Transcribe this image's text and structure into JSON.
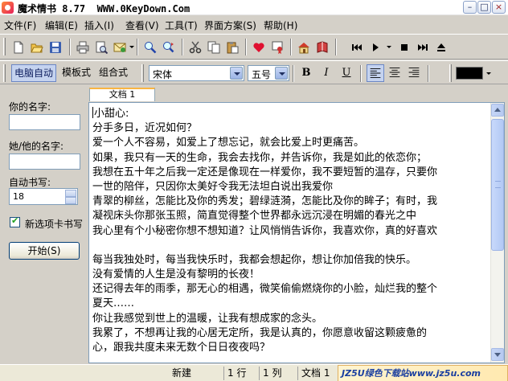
{
  "window": {
    "title": "魔术情书 8.77  WWW.0KeyDown.Com",
    "minimize": "–",
    "maximize": "□",
    "close": "×"
  },
  "menu": [
    "文件(F)",
    "编辑(E)",
    "插入(I)",
    "查看(V)",
    "工具(T)",
    "界面方案(S)",
    "帮助(H)"
  ],
  "toolbar1_icons": [
    "new-icon",
    "open-icon",
    "save-icon",
    "print-icon",
    "print-preview-icon",
    "mail-icon",
    "find-icon",
    "find-replace-icon",
    "cut-icon",
    "copy-icon",
    "paste-icon",
    "heart-icon",
    "certificate-icon",
    "home-icon",
    "book-icon",
    "play-first-icon",
    "play-icon",
    "stop-icon",
    "play-last-icon",
    "eject-icon"
  ],
  "toolbar2": {
    "modes": [
      "电脑自动",
      "模板式",
      "组合式"
    ],
    "active_mode": "电脑自动",
    "font_name": "宋体",
    "font_size": "五号",
    "bold": "B",
    "italic": "I",
    "underline": "U",
    "text_color": "#000000"
  },
  "left_panel": {
    "your_name_label": "你的名字:",
    "your_name_value": "",
    "their_name_label": "她/他的名字:",
    "their_name_value": "",
    "auto_write_label": "自动书写:",
    "auto_write_value": "18",
    "new_tab_label": "新选项卡书写",
    "new_tab_checked": true,
    "start_button": "开始(S)"
  },
  "tabs": [
    {
      "label": "文档 1",
      "active": true
    }
  ],
  "letter": [
    "小甜心:",
    "        分手多日，近况如何？",
    "爱一个人不容易，如爱上了想忘记，就会比爱上时更痛苦。",
    "如果，我只有一天的生命，我会去找你，并告诉你，我是如此的依恋你；",
    "我想在五十年之后我一定还是像现在一样爱你，我不要短暂的温存，只要你",
    "一世的陪伴，只因你太美好令我无法坦白说出我爱你",
    "青翠的柳丝，怎能比及你的秀发；碧绿涟漪，怎能比及你的眸子；有时，我",
    "凝视床头你那张玉照，简直觉得整个世界都永远沉浸在明媚的春光之中",
    "我心里有个小秘密你想不想知道？让风悄悄告诉你，我喜欢你，真的好喜欢",
    "",
    "每当我独处时，每当我快乐时，我都会想起你，想让你加倍我的快乐。",
    "没有爱情的人生是没有黎明的长夜！",
    "还记得去年的雨季，那无心的相遇，微笑偷偷燃烧你的小脸，灿烂我的整个",
    "夏天……",
    "你让我感觉到世上的温暖，让我有想成家的念头。",
    "我累了，不想再让我的心居无定所，我是认真的，你愿意收留这颗疲惫的",
    "心，跟我共度未来无数个日日夜夜吗？"
  ],
  "status": {
    "state": "新建",
    "line": "1 行",
    "col": "1 列",
    "doc": "文档 1",
    "watermark": "JZ5U绿色下载站www.jz5u.com"
  }
}
